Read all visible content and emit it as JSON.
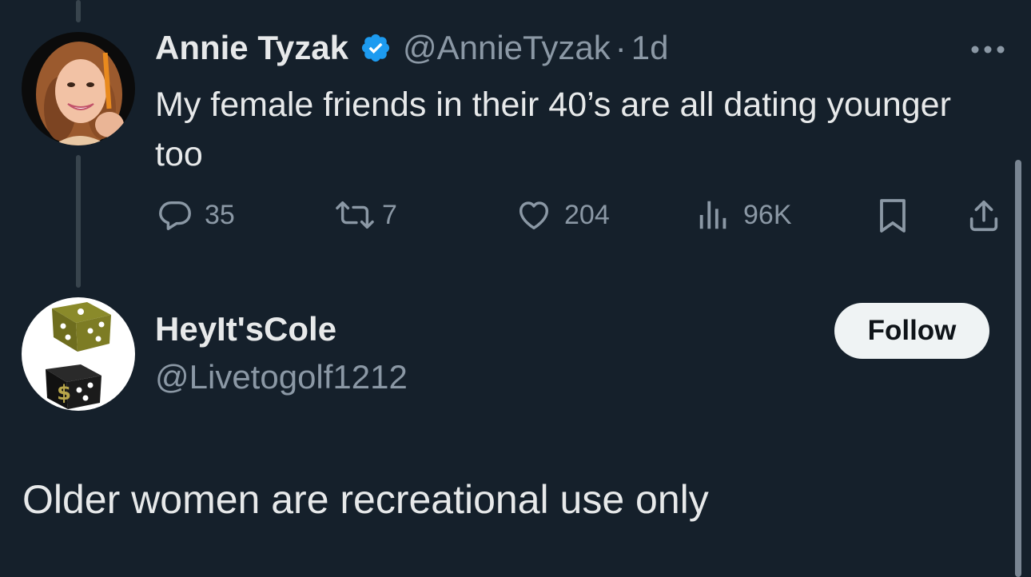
{
  "original_tweet": {
    "author_name": "Annie Tyzak",
    "author_handle": "@AnnieTyzak",
    "separator": "·",
    "age": "1d",
    "text": "My female friends in their 40’s are all dating younger too",
    "verified_icon": "verified-badge-icon",
    "stats": {
      "replies": "35",
      "retweets": "7",
      "likes": "204",
      "views": "96K"
    }
  },
  "reply_tweet": {
    "author_name": "HeyIt'sCole",
    "author_handle": "@Livetogolf1212",
    "follow_label": "Follow",
    "text": "Older women are recreational use only"
  },
  "colors": {
    "background": "#15202b",
    "text_primary": "#e7e9ea",
    "text_secondary": "#8b98a5",
    "verified_blue": "#1d9bf0",
    "follow_bg": "#eff3f4"
  }
}
